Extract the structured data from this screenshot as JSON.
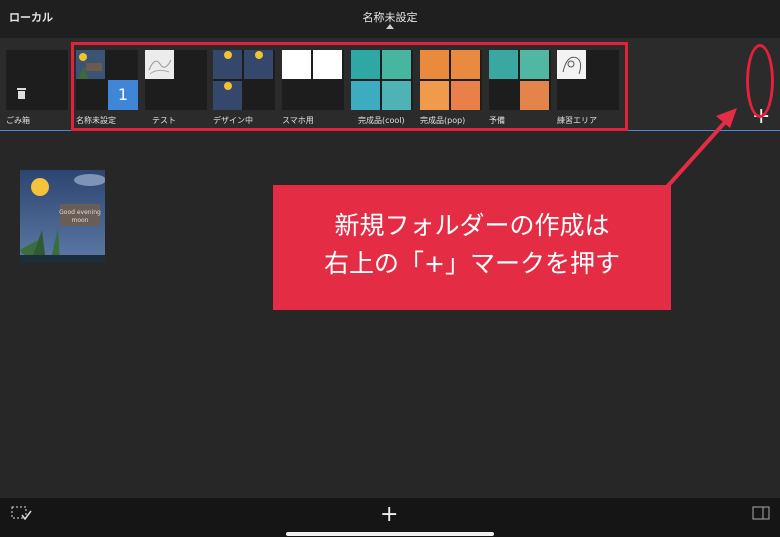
{
  "header": {
    "location": "ローカル",
    "title": "名称未設定"
  },
  "folders": [
    {
      "label": "ごみ箱"
    },
    {
      "label": "名称未設定",
      "count": "1"
    },
    {
      "label": "テスト"
    },
    {
      "label": "デザイン中"
    },
    {
      "label": "スマホ用"
    },
    {
      "label": "完成品(cool)"
    },
    {
      "label": "完成品(pop)"
    },
    {
      "label": "予備"
    },
    {
      "label": "練習エリア"
    }
  ],
  "toolbar": {
    "add_folder": "+"
  },
  "callout": {
    "line1": "新規フォルダーの作成は",
    "line2": "右上の「+」マークを押す"
  },
  "bottombar": {
    "add": "+"
  },
  "colors": {
    "accent": "#3f87d6",
    "annotation": "#e3213d",
    "callout_bg": "#e42d44"
  }
}
